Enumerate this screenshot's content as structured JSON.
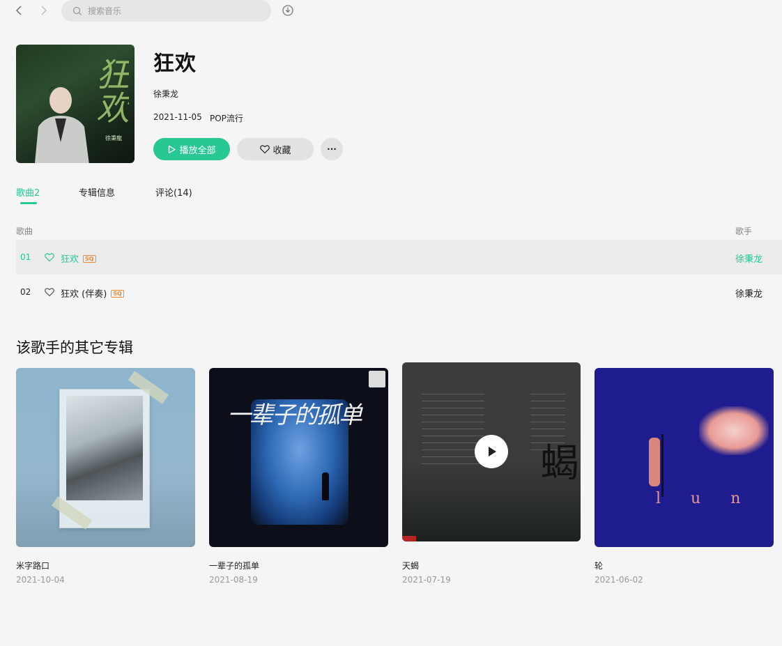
{
  "nav": {
    "search_placeholder": "搜索音乐"
  },
  "album": {
    "title": "狂欢",
    "artist": "徐秉龙",
    "release_date": "2021-11-05",
    "genre": "POP流行",
    "cover_brush_text": "狂欢",
    "cover_small_name": "徐秉龍"
  },
  "actions": {
    "play_all": "播放全部",
    "favorite": "收藏",
    "more": "···"
  },
  "tabs": [
    {
      "label": "歌曲2",
      "active": true
    },
    {
      "label": "专辑信息",
      "active": false
    },
    {
      "label": "评论(14)",
      "active": false
    }
  ],
  "song_list": {
    "headers": {
      "song": "歌曲",
      "artist": "歌手"
    },
    "rows": [
      {
        "num": "01",
        "title": "狂欢",
        "quality": "SQ",
        "artist": "徐秉龙",
        "playing": true
      },
      {
        "num": "02",
        "title": "狂欢 (伴奏)",
        "quality": "SQ",
        "artist": "徐秉龙",
        "playing": false
      }
    ]
  },
  "other_albums": {
    "title": "该歌手的其它专辑",
    "items": [
      {
        "name": "米字路口",
        "date": "2021-10-04"
      },
      {
        "name": "一辈子的孤单",
        "date": "2021-08-19",
        "cover_text": "一辈子的孤单"
      },
      {
        "name": "天蝎",
        "date": "2021-07-19",
        "cover_text": "蝎"
      },
      {
        "name": "轮",
        "date": "2021-06-02",
        "cover_text": "l u n"
      }
    ]
  },
  "colors": {
    "accent": "#28c895",
    "background": "#f5f5f5",
    "sq_badge": "#f08a3a"
  }
}
